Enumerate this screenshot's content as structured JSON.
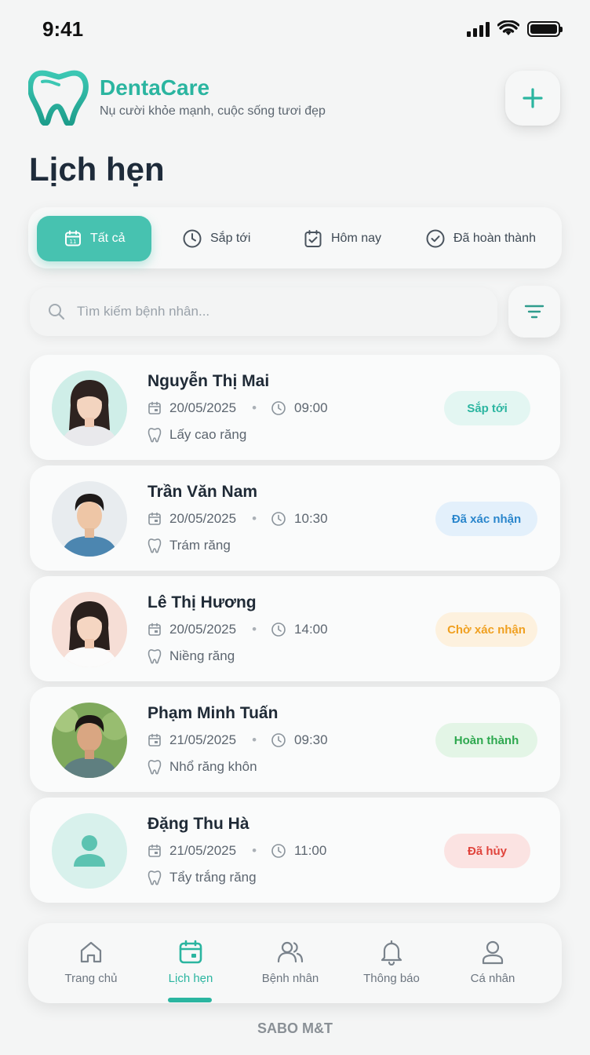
{
  "status_bar": {
    "time": "9:41"
  },
  "header": {
    "brand_name": "DentaCare",
    "tagline": "Nụ cười khỏe mạnh, cuộc sống tươi đẹp",
    "add_icon": "plus-icon"
  },
  "page_title": "Lịch hẹn",
  "tabs": [
    {
      "label": "Tất cả",
      "icon": "calendar-icon",
      "active": true
    },
    {
      "label": "Sắp tới",
      "icon": "clock-icon",
      "active": false
    },
    {
      "label": "Hôm nay",
      "icon": "calendar-check-icon",
      "active": false
    },
    {
      "label": "Đã hoàn thành",
      "icon": "check-circle-icon",
      "active": false
    }
  ],
  "search": {
    "placeholder": "Tìm kiếm bệnh nhân...",
    "value": ""
  },
  "appointments": [
    {
      "name": "Nguyễn Thị Mai",
      "date": "20/05/2025",
      "time": "09:00",
      "service": "Lấy cao răng",
      "status": "Sắp tới",
      "status_color": "#2bb5a0",
      "status_bg": "#e3f6f2"
    },
    {
      "name": "Trần Văn Nam",
      "date": "20/05/2025",
      "time": "10:30",
      "service": "Trám răng",
      "status": "Đã xác nhận",
      "status_color": "#2a86cc",
      "status_bg": "#e3f0fb"
    },
    {
      "name": "Lê Thị Hương",
      "date": "20/05/2025",
      "time": "14:00",
      "service": "Niềng răng",
      "status": "Chờ xác nhận",
      "status_color": "#f0a020",
      "status_bg": "#fdf1de"
    },
    {
      "name": "Phạm Minh Tuấn",
      "date": "21/05/2025",
      "time": "09:30",
      "service": "Nhổ răng khôn",
      "status": "Hoàn thành",
      "status_color": "#2ea84f",
      "status_bg": "#e3f5e6"
    },
    {
      "name": "Đặng Thu Hà",
      "date": "21/05/2025",
      "time": "11:00",
      "service": "Tẩy trắng răng",
      "status": "Đã hủy",
      "status_color": "#e0443c",
      "status_bg": "#fbe3e2"
    }
  ],
  "bottom_nav": [
    {
      "label": "Trang chủ",
      "icon": "home-icon",
      "active": false
    },
    {
      "label": "Lịch hẹn",
      "icon": "calendar-icon",
      "active": true
    },
    {
      "label": "Bệnh nhân",
      "icon": "users-icon",
      "active": false
    },
    {
      "label": "Thông báo",
      "icon": "bell-icon",
      "active": false
    },
    {
      "label": "Cá nhân",
      "icon": "user-icon",
      "active": false
    }
  ],
  "footer_brand": "SABO M&T",
  "colors": {
    "accent": "#2bb5a0",
    "tab_active": "#47c2b0",
    "background": "#f4f5f5"
  }
}
